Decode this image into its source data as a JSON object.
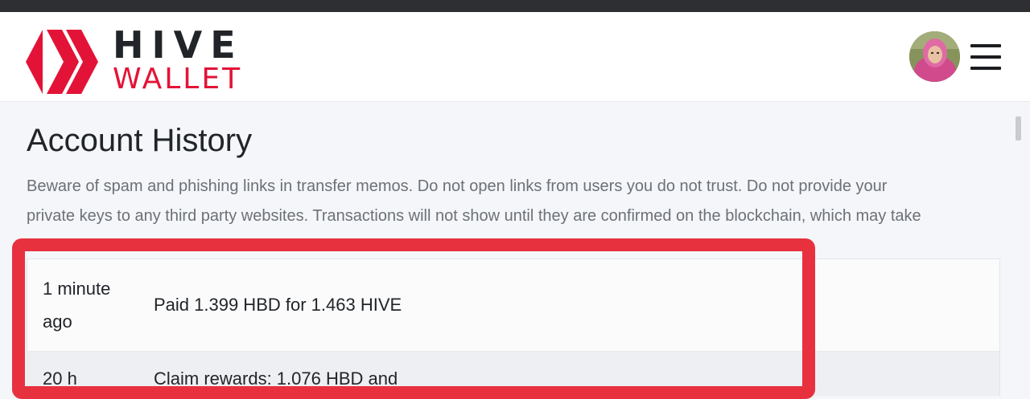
{
  "header": {
    "logo_top": "HIVE",
    "logo_bottom": "WALLET",
    "brand_color": "#e31337",
    "avatar_icon": "user-avatar",
    "menu_icon": "hamburger-menu-icon"
  },
  "page": {
    "title": "Account History",
    "warning_line1": "Beware of spam and phishing links in transfer memos. Do not open links from users you do not trust. Do not provide your",
    "warning_line2": "private keys to any third party websites. Transactions will not show until they are confirmed on the blockchain, which may take"
  },
  "history": {
    "rows": [
      {
        "time": "1 minute ago",
        "description": "Paid 1.399 HBD for 1.463 HIVE"
      },
      {
        "time": "20 h",
        "description": "Claim rewards: 1.076 HBD and"
      }
    ]
  },
  "annotation": {
    "highlight_color": "#e8313f"
  }
}
